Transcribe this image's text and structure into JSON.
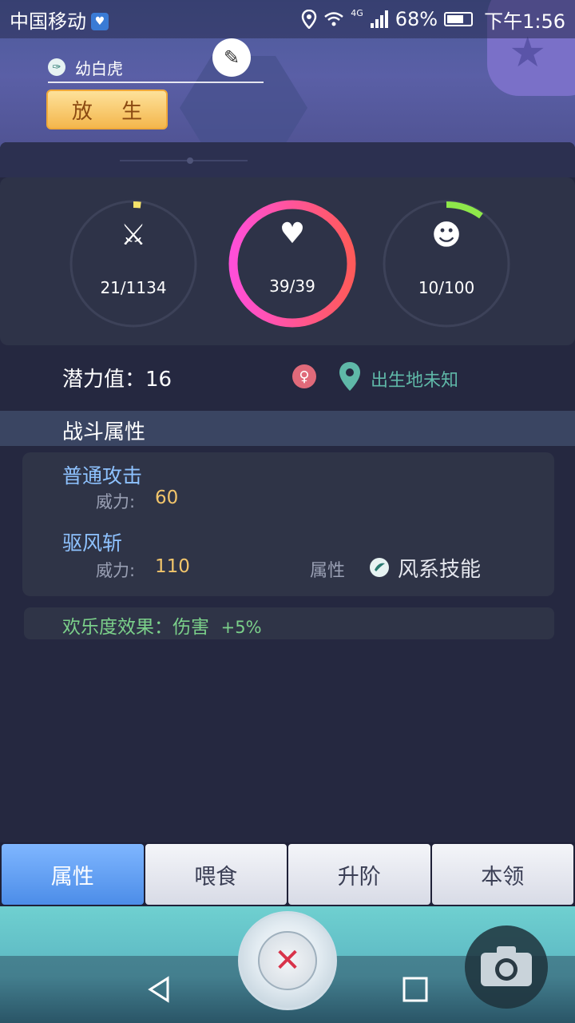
{
  "status_bar": {
    "carrier": "中国移动",
    "network": "4G",
    "battery": "68%",
    "time": "下午1:56"
  },
  "pet": {
    "name": "幼白虎",
    "release_label": "放 生",
    "element_icon": "wind-icon"
  },
  "stats": [
    {
      "icon": "crossed-swords-icon",
      "value": "21/1134",
      "fraction": 0.0185,
      "color": "#f5e26a"
    },
    {
      "icon": "heart-icon",
      "value": "39/39",
      "fraction": 1.0,
      "color": "#ff4fd0"
    },
    {
      "icon": "smiley-icon",
      "value": "10/100",
      "fraction": 0.1,
      "color": "#8ee84a"
    }
  ],
  "potential": {
    "label": "潜力值：16",
    "gender_icon": "female-icon",
    "birthplace": "出生地未知"
  },
  "section_title": "战斗属性",
  "skills": [
    {
      "name": "普通攻击",
      "power_label": "威力:",
      "power": "60"
    },
    {
      "name": "驱风斩",
      "power_label": "威力:",
      "power": "110",
      "attr_label": "属性",
      "attr_value": "风系技能"
    }
  ],
  "joy_effect": {
    "label": "欢乐度效果：伤害",
    "value": "+5%"
  },
  "tabs": [
    "属性",
    "喂食",
    "升阶",
    "本领"
  ],
  "active_tab": 0,
  "colors": {
    "accent_gold": "#f2c56b",
    "skill_blue": "#8ec2ff",
    "joy_green": "#7bd08a",
    "location_teal": "#5fb8a8",
    "tab_active": "#5a9af0"
  }
}
